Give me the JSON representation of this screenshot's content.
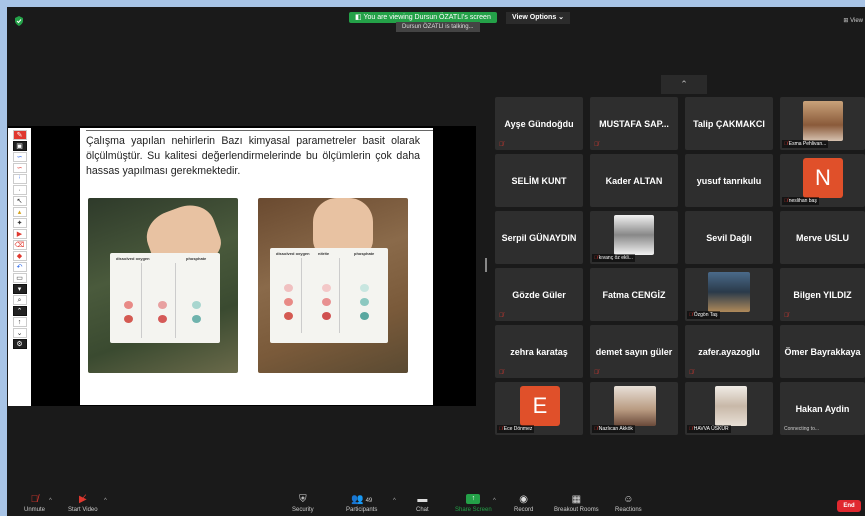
{
  "banner": {
    "viewing": "You are viewing Dursun ÖZATLI's screen",
    "talking": "Dursun ÖZATLI is talking...",
    "view_options": "View Options",
    "view_right": "View"
  },
  "slide": {
    "text": "Çalışma yapılan nehirlerin Bazı kimyasal parametreler basit olarak ölçülmüştür. Su kalitesi değerlendirmelerinde bu ölçümlerin çok daha hassas yapılması gerekmektedir.",
    "card_labels": [
      "dissolved oxygen",
      "nitrite",
      "phosphate"
    ]
  },
  "participants": [
    {
      "name": "Ayşe Gündoğdu"
    },
    {
      "name": "MUSTAFA SAP..."
    },
    {
      "name": "Talip ÇAKMAKCI"
    },
    {
      "name": "",
      "caption": "Esma Pehlivan..."
    },
    {
      "name": "SELİM KUNT"
    },
    {
      "name": "Kader ALTAN"
    },
    {
      "name": "yusuf tanrıkulu"
    },
    {
      "name": "",
      "letter": "N",
      "caption": "neslihan baş"
    },
    {
      "name": "Serpil GÜNAYDIN"
    },
    {
      "name": "",
      "caption": "kıvanç öz ekli..."
    },
    {
      "name": "Sevil Dağlı"
    },
    {
      "name": "Merve USLU"
    },
    {
      "name": "Gözde Güler"
    },
    {
      "name": "Fatma CENGİZ"
    },
    {
      "name": "",
      "caption": "Özgön Taş"
    },
    {
      "name": "Bilgen YILDIZ"
    },
    {
      "name": "zehra karataş"
    },
    {
      "name": "demet sayın güler"
    },
    {
      "name": "zafer.ayazoglu"
    },
    {
      "name": "Ömer Bayrakkaya"
    },
    {
      "name": "",
      "letter": "E",
      "caption": "Ece Dönmez"
    },
    {
      "name": "",
      "caption": "Nazlıcan Akkök"
    },
    {
      "name": "",
      "caption": "HAVVA ÜSKÜR"
    },
    {
      "name": "Hakan Aydin",
      "caption": "Connecting to..."
    }
  ],
  "toolbar": {
    "unmute": "Unmute",
    "start_video": "Start Video",
    "security": "Security",
    "participants": "Participants",
    "participants_count": "49",
    "chat": "Chat",
    "share_screen": "Share Screen",
    "record": "Record",
    "breakout_rooms": "Breakout Rooms",
    "reactions": "Reactions",
    "end": "End"
  },
  "colors": {
    "share_green": "#24a148",
    "end_red": "#e0282f",
    "letter_avatar": "#e0502a",
    "tile_bg": "#2e2e2e"
  }
}
